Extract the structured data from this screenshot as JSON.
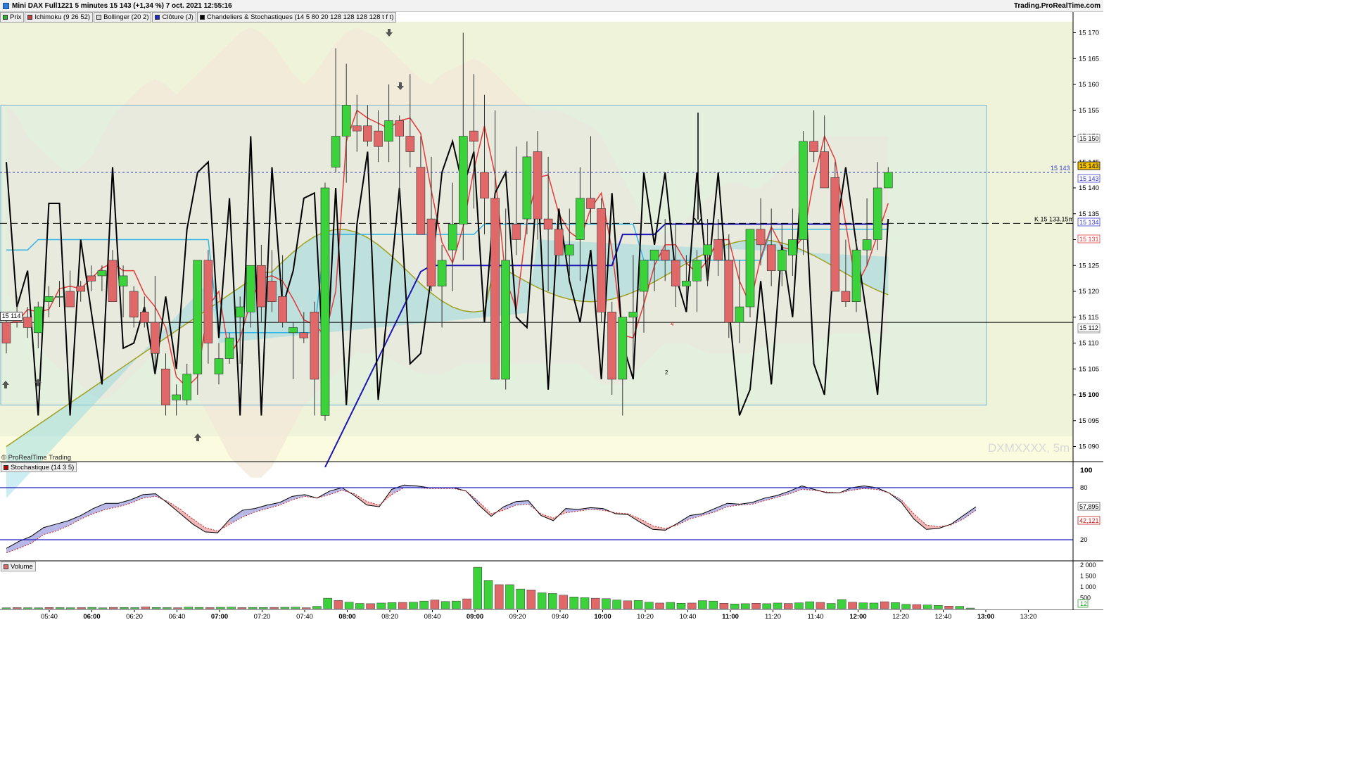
{
  "window": {
    "title": "Mini DAX Full1221 5 minutes 15 143 (+1,34 %) 7 oct. 2021 12:55:16",
    "brand": "Trading.ProRealTime.com"
  },
  "legend": [
    {
      "label": "Prix",
      "color": "#30b030"
    },
    {
      "label": "Ichimoku (9 26 52)",
      "color": "#c04040"
    },
    {
      "label": "Bollinger (20 2)",
      "color": "#d8d8d8"
    },
    {
      "label": "Clôture (J)",
      "color": "#2828c8"
    },
    {
      "label": "Chandeliers & Stochastiques (14 5 80 20 128 128 128 128 t f t)",
      "color": "#000000"
    }
  ],
  "main_pane": {
    "watermark": "DXMXXXX, 5m",
    "credit": "© ProRealTime Trading",
    "price_box": "15 114",
    "y_ticks": [
      "15 170",
      "15 165",
      "15 160",
      "15 155",
      "15 150",
      "15 145",
      "15 140",
      "15 135",
      "15 130",
      "15 125",
      "15 120",
      "15 115",
      "15 110",
      "15 105",
      "15 100",
      "15 095",
      "15 090"
    ],
    "right_markers": [
      {
        "value": 15150,
        "label": "15 150"
      },
      {
        "value": 15143,
        "label": "15 143"
      },
      {
        "value": 15143,
        "label": "15 143"
      },
      {
        "value": 15134,
        "label": "15 134"
      },
      {
        "value": 15131,
        "label": "15 131"
      },
      {
        "value": 15113,
        "label": "15 113"
      },
      {
        "value": 15112,
        "label": "15 112"
      }
    ],
    "level_label": "15 143",
    "kijun_label": "K 15 133.15m",
    "annotations": [
      "4",
      "2"
    ]
  },
  "stochastic_pane": {
    "label": "Stochastique (14 3 5)",
    "y_ticks": [
      "100",
      "80",
      "20"
    ],
    "values": [
      "57,895",
      "42,121"
    ]
  },
  "volume_pane": {
    "label": "Volume",
    "y_ticks": [
      "2 000",
      "1 500",
      "1 000",
      "500"
    ],
    "last_value": "12"
  },
  "x_ticks": [
    "05:40",
    "06:00",
    "06:20",
    "06:40",
    "07:00",
    "07:20",
    "07:40",
    "08:00",
    "08:20",
    "08:40",
    "09:00",
    "09:20",
    "09:40",
    "10:00",
    "10:20",
    "10:40",
    "11:00",
    "11:20",
    "11:40",
    "12:00",
    "12:20",
    "12:40",
    "13:00",
    "13:20"
  ],
  "x_ticks_bold": [
    "06:00",
    "07:00",
    "08:00",
    "09:00",
    "10:00",
    "11:00",
    "12:00",
    "13:00"
  ],
  "colors": {
    "up": "#3cd23c",
    "down": "#e06868",
    "kijun": "#33b5e5",
    "tenkan": "#e33a3a",
    "chikou": "#1d14b4",
    "span": "#a0a020",
    "stochastic": "#000000"
  },
  "chart_data": {
    "type": "candlestick",
    "ohlc": [
      [
        15114,
        15116,
        15108,
        15110
      ],
      [
        15115,
        15119,
        15113,
        15114
      ],
      [
        15115,
        15117,
        15111,
        15113
      ],
      [
        15112,
        15118,
        15109,
        15117
      ],
      [
        15118,
        15121,
        15115,
        15119
      ],
      [
        15119,
        15122,
        15117,
        15119
      ],
      [
        15120,
        15124,
        15117,
        15117
      ],
      [
        15121,
        15122,
        15118,
        15120
      ],
      [
        15123,
        15125,
        15120,
        15122
      ],
      [
        15123,
        15125,
        15120,
        15124
      ],
      [
        15126,
        15128,
        15119,
        15118
      ],
      [
        15121,
        15125,
        15115,
        15123
      ],
      [
        15120,
        15121,
        15113,
        15115
      ],
      [
        15116,
        15119,
        15113,
        15114
      ],
      [
        15114,
        15123,
        15104,
        15108
      ],
      [
        15105,
        15108,
        15096,
        15098
      ],
      [
        15099,
        15102,
        15096,
        15100
      ],
      [
        15099,
        15106,
        15098,
        15104
      ],
      [
        15104,
        15121,
        15100,
        15126
      ],
      [
        15126,
        15128,
        15106,
        15110
      ],
      [
        15104,
        15110,
        15102,
        15107
      ],
      [
        15107,
        15112,
        15106,
        15111
      ],
      [
        15115,
        15119,
        15106,
        15117
      ],
      [
        15116,
        15119,
        15113,
        15125
      ],
      [
        15125,
        15129,
        15114,
        15117
      ],
      [
        15122,
        15128,
        15116,
        15118
      ],
      [
        15119,
        15127,
        15113,
        15114
      ],
      [
        15112,
        15114,
        15103,
        15113
      ],
      [
        15112,
        15116,
        15110,
        15111
      ],
      [
        15116,
        15118,
        15096,
        15103
      ],
      [
        15096,
        15141,
        15095,
        15140
      ],
      [
        15144,
        15167,
        15143,
        15150
      ],
      [
        15150,
        15164,
        15141,
        15156
      ],
      [
        15152,
        15158,
        15147,
        15151
      ],
      [
        15152,
        15156,
        15148,
        15149
      ],
      [
        15151,
        15155,
        15145,
        15148
      ],
      [
        15149,
        15160,
        15145,
        15153
      ],
      [
        15153,
        15154,
        15138,
        15150
      ],
      [
        15150,
        15162,
        15144,
        15147
      ],
      [
        15144,
        15150,
        15133,
        15131
      ],
      [
        15134,
        15146,
        15120,
        15121
      ],
      [
        15121,
        15129,
        15113,
        15126
      ],
      [
        15128,
        15141,
        15120,
        15133
      ],
      [
        15133,
        15170,
        15126,
        15150
      ],
      [
        15151,
        15162,
        15136,
        15149
      ],
      [
        15143,
        15158,
        15131,
        15138
      ],
      [
        15138,
        15155,
        15103,
        15103
      ],
      [
        15103,
        15136,
        15101,
        15126
      ],
      [
        15133,
        15148,
        15127,
        15130
      ],
      [
        15134,
        15149,
        15131,
        15146
      ],
      [
        15147,
        15151,
        15130,
        15134
      ],
      [
        15134,
        15146,
        15120,
        15132
      ],
      [
        15132,
        15134,
        15125,
        15127
      ],
      [
        15127,
        15136,
        15123,
        15129
      ],
      [
        15130,
        15144,
        15122,
        15138
      ],
      [
        15138,
        15150,
        15133,
        15136
      ],
      [
        15136,
        15138,
        15114,
        15116
      ],
      [
        15116,
        15118,
        15100,
        15103
      ],
      [
        15103,
        15113,
        15096,
        15115
      ],
      [
        15115,
        15127,
        15104,
        15116
      ],
      [
        15120,
        15126,
        15112,
        15126
      ],
      [
        15126,
        15128,
        15120,
        15128
      ],
      [
        15128,
        15134,
        15122,
        15126
      ],
      [
        15126,
        15133,
        15117,
        15121
      ],
      [
        15121,
        15127,
        15117,
        15122
      ],
      [
        15122,
        15128,
        15116,
        15126
      ],
      [
        15127,
        15134,
        15121,
        15129
      ],
      [
        15130,
        15134,
        15123,
        15126
      ],
      [
        15126,
        15131,
        15111,
        15114
      ],
      [
        15114,
        15126,
        15110,
        15117
      ],
      [
        15117,
        15130,
        15115,
        15132
      ],
      [
        15132,
        15138,
        15125,
        15129
      ],
      [
        15129,
        15136,
        15121,
        15124
      ],
      [
        15124,
        15133,
        15121,
        15128
      ],
      [
        15127,
        15136,
        15123,
        15130
      ],
      [
        15130,
        15151,
        15127,
        15149
      ],
      [
        15149,
        15155,
        15145,
        15147
      ],
      [
        15147,
        15154,
        15144,
        15140
      ],
      [
        15142,
        15145,
        15120,
        15120
      ],
      [
        15120,
        15130,
        15117,
        15118
      ],
      [
        15118,
        15130,
        15116,
        15128
      ],
      [
        15128,
        15138,
        15125,
        15130
      ],
      [
        15130,
        15145,
        15128,
        15140
      ],
      [
        15140,
        15144,
        15140,
        15143
      ]
    ],
    "volume": [
      40,
      50,
      45,
      40,
      55,
      50,
      45,
      50,
      60,
      40,
      60,
      55,
      50,
      80,
      55,
      50,
      45,
      70,
      60,
      50,
      65,
      70,
      50,
      60,
      55,
      60,
      65,
      70,
      45,
      110,
      480,
      380,
      300,
      240,
      230,
      260,
      280,
      290,
      300,
      350,
      400,
      330,
      350,
      450,
      1900,
      1300,
      1100,
      1100,
      900,
      860,
      730,
      700,
      620,
      540,
      510,
      480,
      460,
      400,
      360,
      380,
      300,
      260,
      290,
      250,
      260,
      370,
      350,
      250,
      220,
      230,
      250,
      230,
      260,
      240,
      270,
      320,
      290,
      240,
      420,
      300,
      270,
      260,
      320,
      280,
      200,
      190,
      170,
      150,
      120,
      110,
      30
    ],
    "stochastic": [
      10,
      18,
      24,
      34,
      38,
      42,
      48,
      56,
      62,
      62,
      66,
      72,
      73,
      62,
      50,
      38,
      29,
      28,
      44,
      54,
      56,
      60,
      63,
      70,
      72,
      68,
      76,
      80,
      71,
      60,
      58,
      78,
      83,
      82,
      80,
      80,
      80,
      76,
      60,
      47,
      58,
      64,
      65,
      48,
      42,
      56,
      55,
      57,
      56,
      50,
      49,
      40,
      32,
      31,
      39,
      48,
      50,
      56,
      62,
      61,
      63,
      68,
      71,
      76,
      82,
      78,
      74,
      74,
      80,
      82,
      80,
      74,
      63,
      44,
      32,
      33,
      38,
      48,
      58
    ],
    "stochastic_signal": [
      5,
      10,
      16,
      26,
      30,
      36,
      44,
      50,
      55,
      58,
      62,
      68,
      70,
      64,
      55,
      44,
      34,
      30,
      38,
      46,
      52,
      56,
      60,
      66,
      70,
      68,
      72,
      77,
      73,
      64,
      60,
      72,
      80,
      80,
      79,
      79,
      79,
      76,
      64,
      50,
      54,
      60,
      61,
      50,
      45,
      51,
      53,
      55,
      54,
      51,
      50,
      44,
      36,
      33,
      37,
      44,
      48,
      52,
      58,
      60,
      61,
      65,
      69,
      73,
      78,
      77,
      75,
      74,
      77,
      79,
      78,
      74,
      66,
      50,
      37,
      35,
      37,
      44,
      54
    ]
  }
}
